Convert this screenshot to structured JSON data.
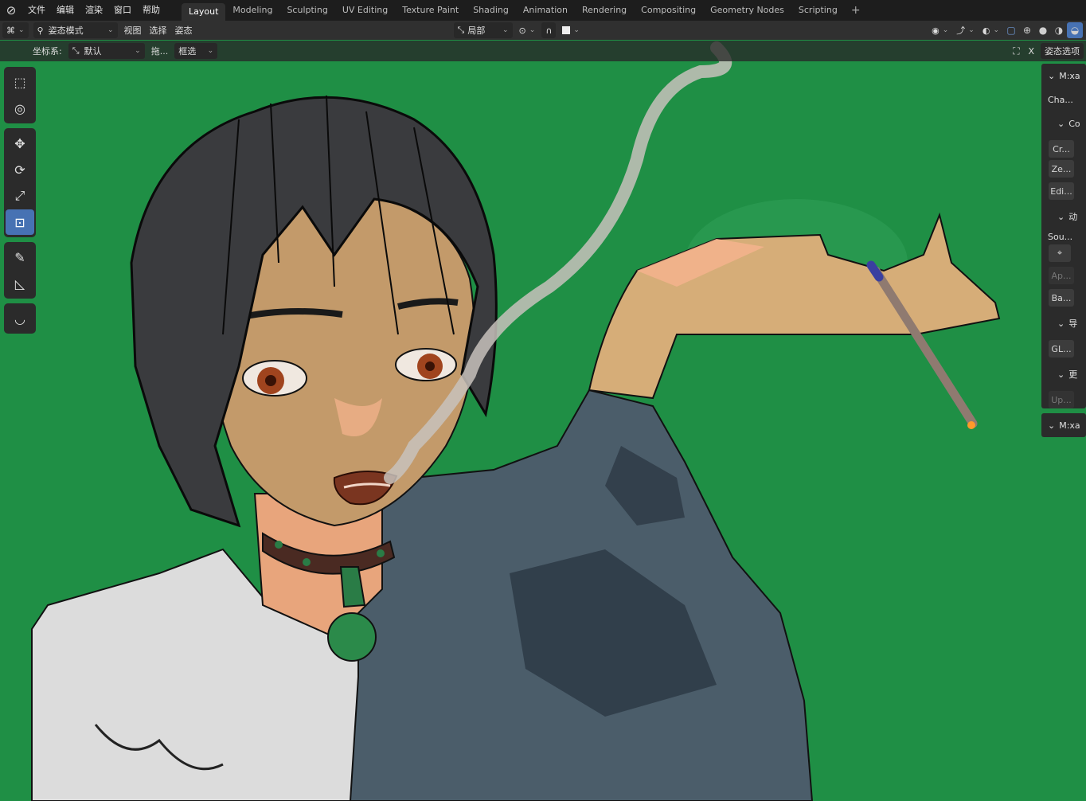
{
  "colors": {
    "viewport_bg": "#1f8f45",
    "accent": "#4772b3",
    "header_bg": "#1d1d1d"
  },
  "menu": [
    {
      "label": "文件"
    },
    {
      "label": "编辑"
    },
    {
      "label": "渲染"
    },
    {
      "label": "窗口"
    },
    {
      "label": "帮助"
    }
  ],
  "workspaces": [
    {
      "label": "Layout",
      "active": true
    },
    {
      "label": "Modeling"
    },
    {
      "label": "Sculpting"
    },
    {
      "label": "UV Editing"
    },
    {
      "label": "Texture Paint"
    },
    {
      "label": "Shading"
    },
    {
      "label": "Animation"
    },
    {
      "label": "Rendering"
    },
    {
      "label": "Compositing"
    },
    {
      "label": "Geometry Nodes"
    },
    {
      "label": "Scripting"
    }
  ],
  "header": {
    "mode_label": "姿态模式",
    "view": "视图",
    "select": "选择",
    "pose": "姿态",
    "transform_orientation": "局部"
  },
  "tool_header": {
    "coord_label": "坐标系:",
    "coord_value": "默认",
    "drag_label": "拖...",
    "select_mode": "框选",
    "options_label": "姿态选项",
    "x_label": "X"
  },
  "tools": [
    {
      "name": "select-box",
      "icon": "▣"
    },
    {
      "name": "cursor",
      "icon": "◎"
    },
    {
      "name": "move",
      "icon": "✥"
    },
    {
      "name": "rotate",
      "icon": "⟳"
    },
    {
      "name": "scale",
      "icon": "⤢"
    },
    {
      "name": "transform",
      "icon": "⊡",
      "active": true
    },
    {
      "name": "annotate",
      "icon": "✎"
    },
    {
      "name": "measure",
      "icon": "📐"
    },
    {
      "name": "relax-pose",
      "icon": "◡"
    }
  ],
  "npanel": {
    "header1": "M:xa",
    "cha": "Cha...",
    "sub_co": "Co",
    "btn_cr": "Cr...",
    "btn_ze": "Ze...",
    "btn_edi": "Edi...",
    "sub_dong": "动",
    "sou": "Sou...",
    "btn_ap": "Ap...",
    "btn_ba": "Ba...",
    "sub_dao": "导",
    "btn_gl": "GL...",
    "sub_geng": "更",
    "btn_up": "Up...",
    "footer": "M:xa"
  }
}
